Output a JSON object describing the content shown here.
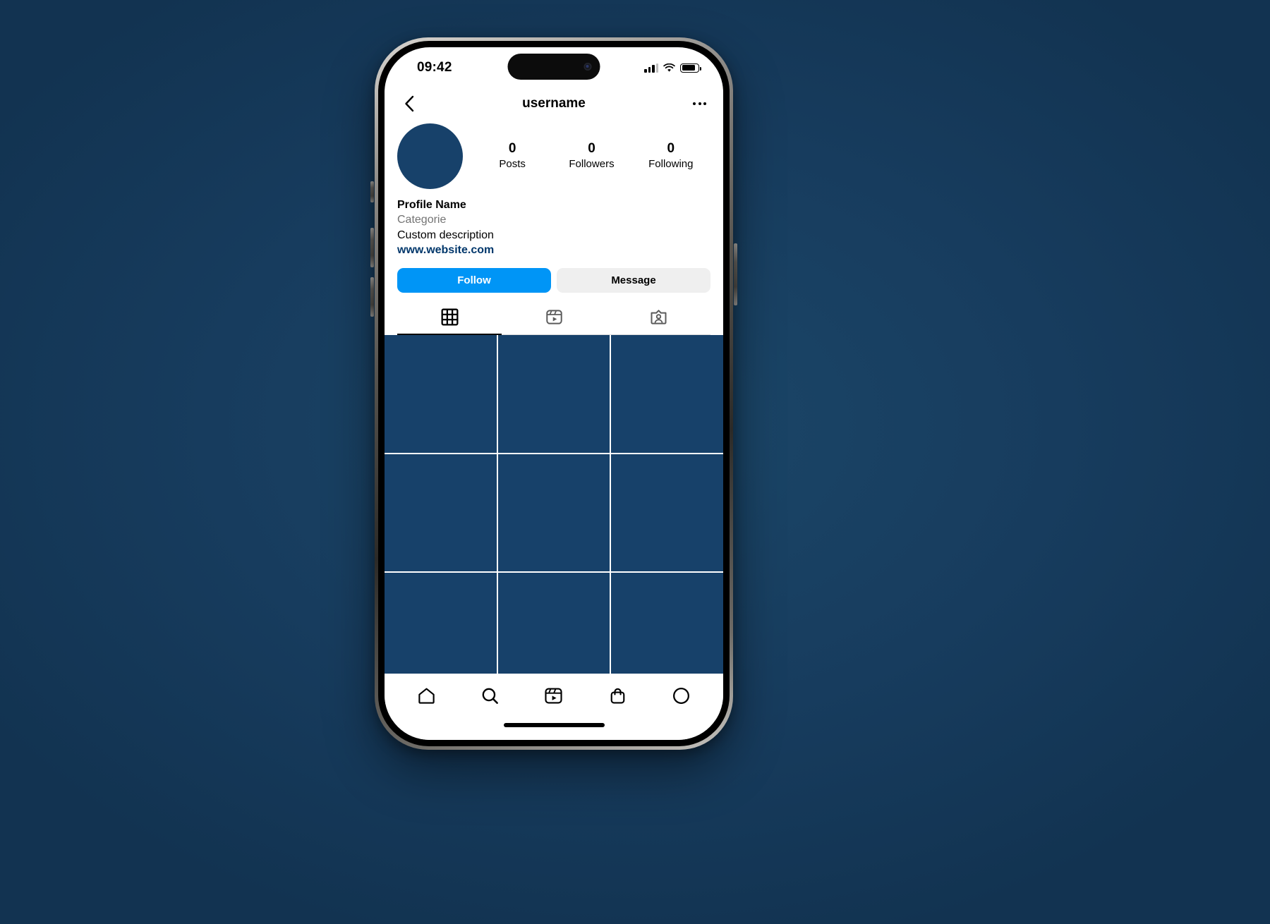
{
  "theme": {
    "backdrop_color": "#173C5E",
    "accent_blue": "#0095F6",
    "placeholder_navy": "#17416A",
    "link_blue": "#00376B",
    "muted_gray": "#737373",
    "button_gray": "#EFEFEF"
  },
  "status_bar": {
    "time": "09:42",
    "signal_icon": "cellular-signal-icon",
    "wifi_icon": "wifi-icon",
    "battery_icon": "battery-icon",
    "dynamic_island": "dynamic-island"
  },
  "header": {
    "back_icon": "chevron-left-icon",
    "title": "username",
    "more_icon": "more-options-icon"
  },
  "profile": {
    "avatar": "profile-avatar",
    "stats": [
      {
        "value": "0",
        "label": "Posts"
      },
      {
        "value": "0",
        "label": "Followers"
      },
      {
        "value": "0",
        "label": "Following"
      }
    ],
    "name": "Profile Name",
    "category": "Categorie",
    "description": "Custom description",
    "website": "www.website.com",
    "follow_label": "Follow",
    "message_label": "Message"
  },
  "profile_tabs": [
    {
      "name": "grid-tab",
      "icon": "grid-icon",
      "active": true
    },
    {
      "name": "reels-tab",
      "icon": "reels-icon",
      "active": false
    },
    {
      "name": "tagged-tab",
      "icon": "tagged-person-icon",
      "active": false
    }
  ],
  "post_grid": {
    "columns": 3,
    "cell_count": 12,
    "cell_color": "#17416A"
  },
  "bottom_nav": [
    {
      "name": "nav-home",
      "icon": "home-icon"
    },
    {
      "name": "nav-search",
      "icon": "search-icon"
    },
    {
      "name": "nav-reels",
      "icon": "reels-icon"
    },
    {
      "name": "nav-shop",
      "icon": "shopping-bag-icon"
    },
    {
      "name": "nav-profile",
      "icon": "profile-circle-icon"
    }
  ]
}
